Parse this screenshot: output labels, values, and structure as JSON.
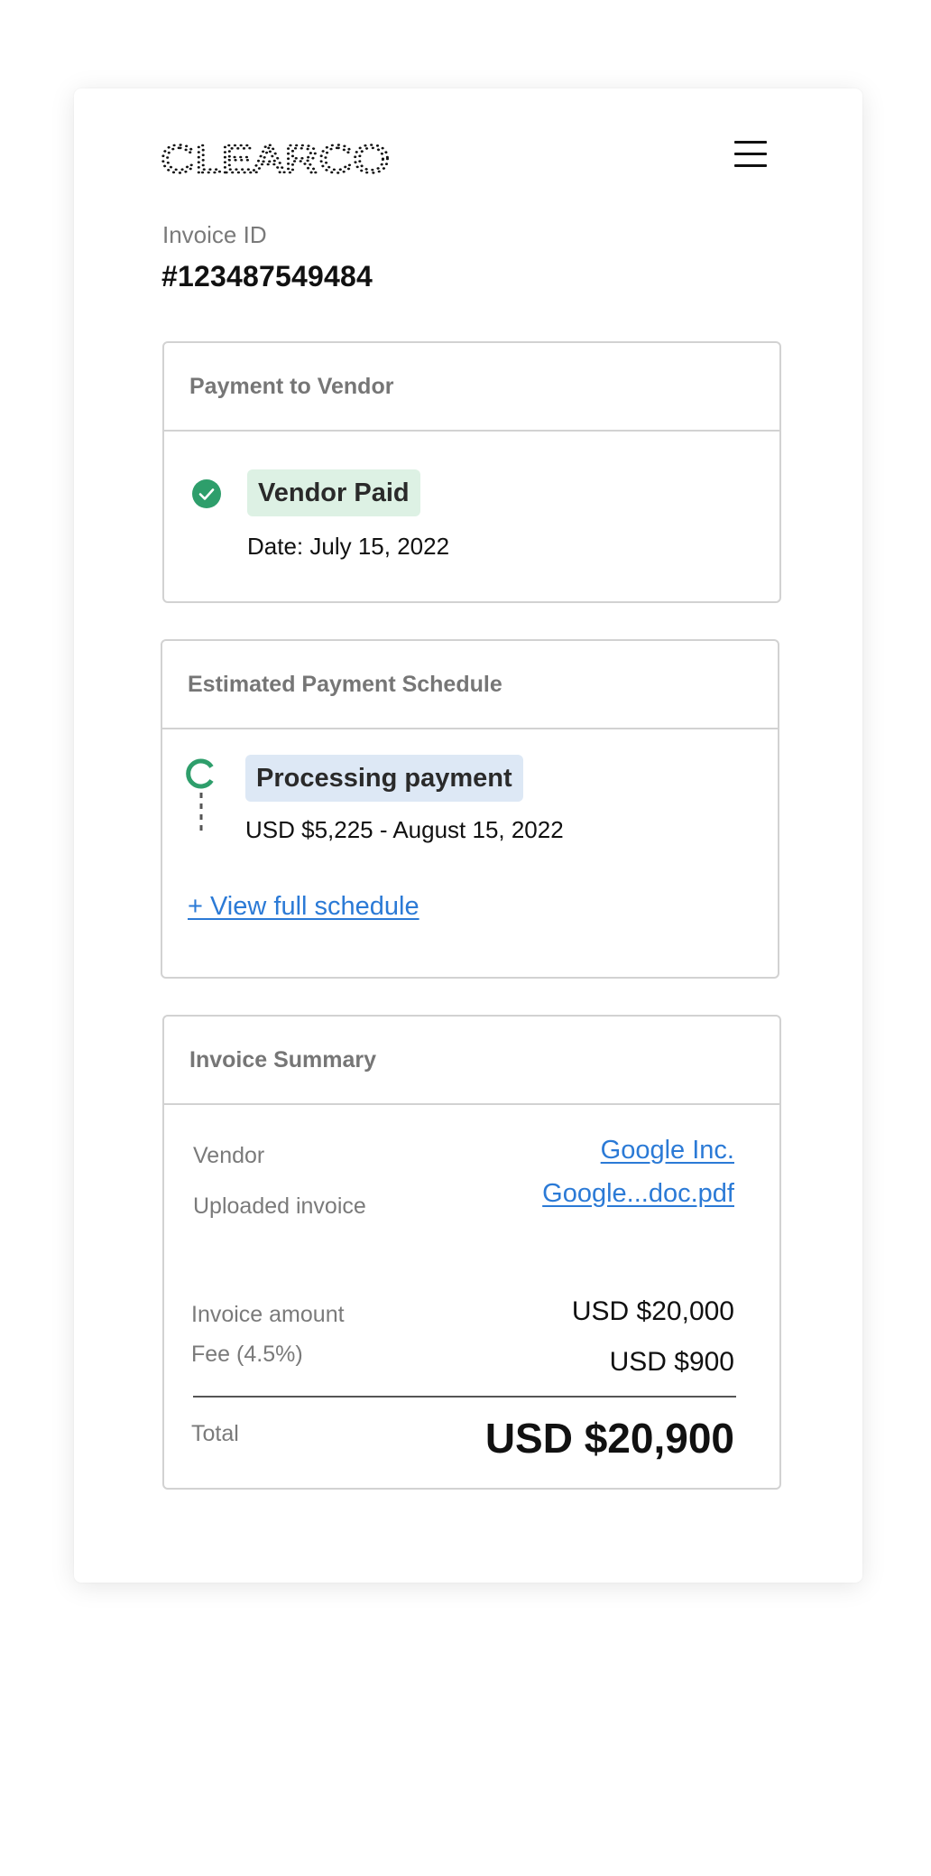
{
  "header": {
    "logo_text": "CLEARCO",
    "menu_icon": "hamburger-menu-icon"
  },
  "invoice": {
    "id_label": "Invoice ID",
    "id_value": "#123487549484"
  },
  "vendor_payment": {
    "title": "Payment to Vendor",
    "status_icon": "check-circle-icon",
    "status": "Vendor Paid",
    "date": "Date: July 15, 2022"
  },
  "schedule": {
    "title": "Estimated Payment Schedule",
    "status_icon": "spinner-icon",
    "status": "Processing payment",
    "line": "USD $5,225 - August 15, 2022",
    "view_link": "+ View full schedule"
  },
  "summary": {
    "title": "Invoice Summary",
    "vendor_label": "Vendor",
    "vendor_value": "Google Inc.",
    "uploaded_label": "Uploaded invoice",
    "uploaded_value": "Google...doc.pdf",
    "amount_label": "Invoice amount",
    "amount_value": "USD $20,000",
    "fee_label": "Fee (4.5%)",
    "fee_value": "USD $900",
    "total_label": "Total",
    "total_value": "USD $20,900"
  },
  "colors": {
    "success_green": "#2e9e6b",
    "paid_badge_bg": "#ddf1e4",
    "processing_badge_bg": "#dde8f5",
    "link_blue": "#2b7ad6"
  }
}
